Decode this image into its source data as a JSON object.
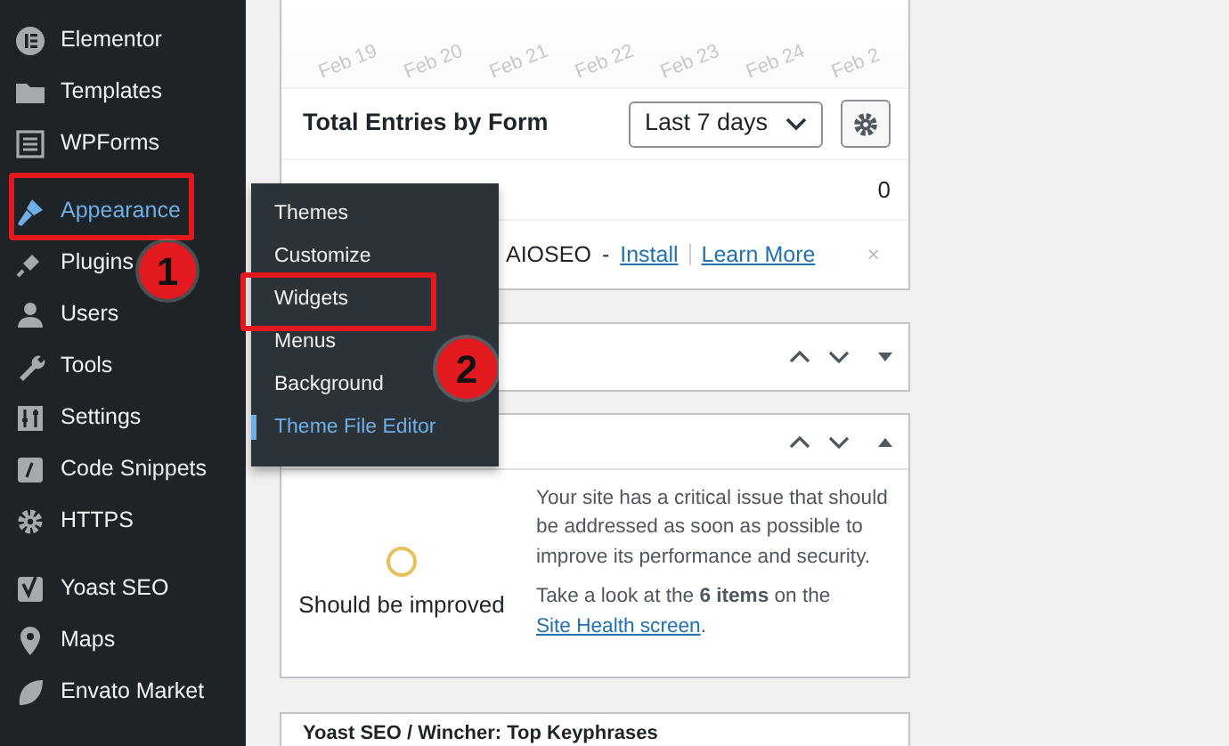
{
  "sidebar": {
    "groups": [
      [
        {
          "label": "Elementor",
          "selected": false
        },
        {
          "label": "Templates",
          "selected": false
        },
        {
          "label": "WPForms",
          "selected": false
        }
      ],
      [
        {
          "label": "Appearance",
          "selected": true
        },
        {
          "label": "Plugins",
          "selected": false
        },
        {
          "label": "Users",
          "selected": false
        },
        {
          "label": "Tools",
          "selected": false
        },
        {
          "label": "Settings",
          "selected": false
        },
        {
          "label": "Code Snippets",
          "selected": false
        },
        {
          "label": "HTTPS",
          "selected": false
        }
      ],
      [
        {
          "label": "Yoast SEO",
          "selected": false
        },
        {
          "label": "Maps",
          "selected": false
        },
        {
          "label": "Envato Market",
          "selected": false
        }
      ]
    ]
  },
  "submenu": {
    "items": [
      {
        "label": "Themes",
        "selected": false
      },
      {
        "label": "Customize",
        "selected": false
      },
      {
        "label": "Widgets",
        "selected": false
      },
      {
        "label": "Menus",
        "selected": false
      },
      {
        "label": "Background",
        "selected": false
      },
      {
        "label": "Theme File Editor",
        "selected": true
      }
    ]
  },
  "annotations": [
    {
      "number": "1"
    },
    {
      "number": "2"
    }
  ],
  "entries_panel": {
    "chart": {
      "x_labels": [
        "Feb 19",
        "Feb 20",
        "Feb 21",
        "Feb 22",
        "Feb 23",
        "Feb 24",
        "Feb 2"
      ]
    },
    "title": "Total Entries by Form",
    "range_select": {
      "value": "Last 7 days"
    },
    "rows": [
      {
        "count": "0"
      }
    ],
    "notice": {
      "text": "AIOSEO",
      "separator": "-",
      "links": [
        "Install",
        "Learn More"
      ],
      "dismiss": "×"
    }
  },
  "panels": [
    {
      "expanded": false
    },
    {
      "expanded": true,
      "status": "Should be improved",
      "message": "Your site has a critical issue that should be addressed as soon as possible to improve its performance and security.",
      "hint": "Take a look at the **6 items** on the ",
      "link": "Site Health screen",
      "hint_end": "."
    },
    {
      "title": "Yoast SEO / Wincher: Top Keyphrases"
    }
  ]
}
